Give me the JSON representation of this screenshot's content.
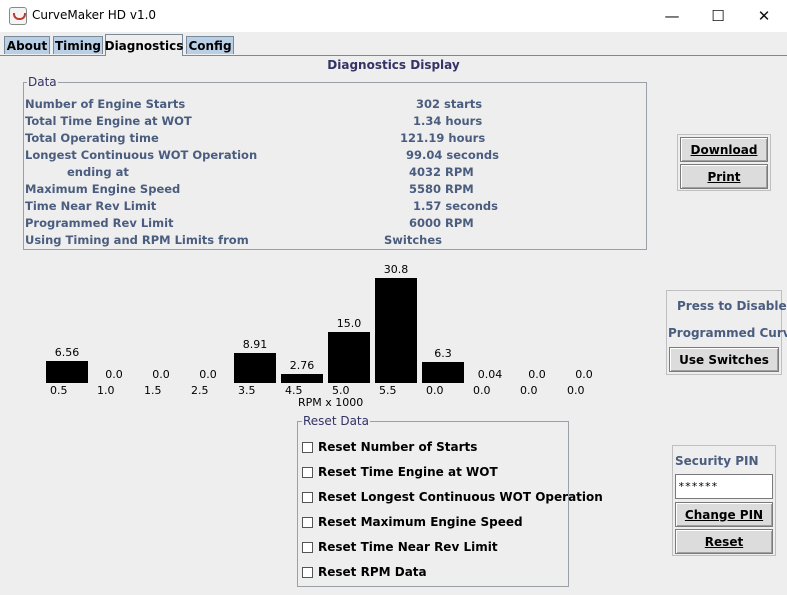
{
  "window": {
    "title": "CurveMaker HD v1.0",
    "minimize_glyph": "—",
    "maximize_glyph": "☐",
    "close_glyph": "✕"
  },
  "tabs": [
    {
      "label": "About",
      "active": false
    },
    {
      "label": "Timing",
      "active": false
    },
    {
      "label": "Diagnostics",
      "active": true
    },
    {
      "label": "Config",
      "active": false
    }
  ],
  "panel_title": "Diagnostics Display",
  "data_group": {
    "legend": "Data",
    "rows": [
      {
        "label": "Number of Engine Starts",
        "value": "302 starts"
      },
      {
        "label": "Total Time Engine at WOT",
        "value": "1.34 hours"
      },
      {
        "label": "Total Operating time",
        "value": "121.19 hours"
      },
      {
        "label": "Longest Continuous WOT Operation",
        "value": "99.04 seconds"
      },
      {
        "label": "ending at",
        "value": "4032 RPM"
      },
      {
        "label": "Maximum Engine Speed",
        "value": "5580 RPM"
      },
      {
        "label": "Time Near Rev Limit",
        "value": "1.57 seconds"
      },
      {
        "label": "Programmed Rev Limit",
        "value": "6000 RPM"
      },
      {
        "label": "Using Timing and RPM Limits from",
        "value": "Switches"
      }
    ]
  },
  "buttons": {
    "download": "Download",
    "print": "Print",
    "use_switches": "Use Switches",
    "change_pin": "Change PIN",
    "reset": "Reset"
  },
  "disable_box": {
    "line1": "Press to Disable",
    "line2": "Programmed Curve"
  },
  "security": {
    "label": "Security PIN",
    "pin_value": "******"
  },
  "chart_data": {
    "type": "bar",
    "xlabel": "RPM x 1000",
    "categories": [
      "0.5",
      "1.0",
      "1.5",
      "2.5",
      "3.5",
      "4.5",
      "5.0",
      "5.5",
      "0.0",
      "0.0",
      "0.0",
      "0.0"
    ],
    "value_labels": [
      "6.56",
      "0.0",
      "0.0",
      "0.0",
      "8.91",
      "2.76",
      "15.0",
      "30.8",
      "6.3",
      "0.04",
      "0.0",
      "0.0"
    ],
    "values": [
      6.56,
      0.0,
      0.0,
      0.0,
      8.91,
      2.76,
      15.0,
      30.8,
      6.3,
      0.04,
      0.0,
      0.0
    ],
    "ylim": [
      0,
      30.8
    ]
  },
  "reset_group": {
    "legend": "Reset Data",
    "items": [
      {
        "label": "Reset Number of Starts",
        "checked": false
      },
      {
        "label": "Reset Time Engine at WOT",
        "checked": false
      },
      {
        "label": "Reset Longest Continuous WOT Operation",
        "checked": false
      },
      {
        "label": "Reset Maximum Engine Speed",
        "checked": false
      },
      {
        "label": "Reset Time Near Rev Limit",
        "checked": false
      },
      {
        "label": "Reset RPM Data",
        "checked": false
      }
    ]
  }
}
